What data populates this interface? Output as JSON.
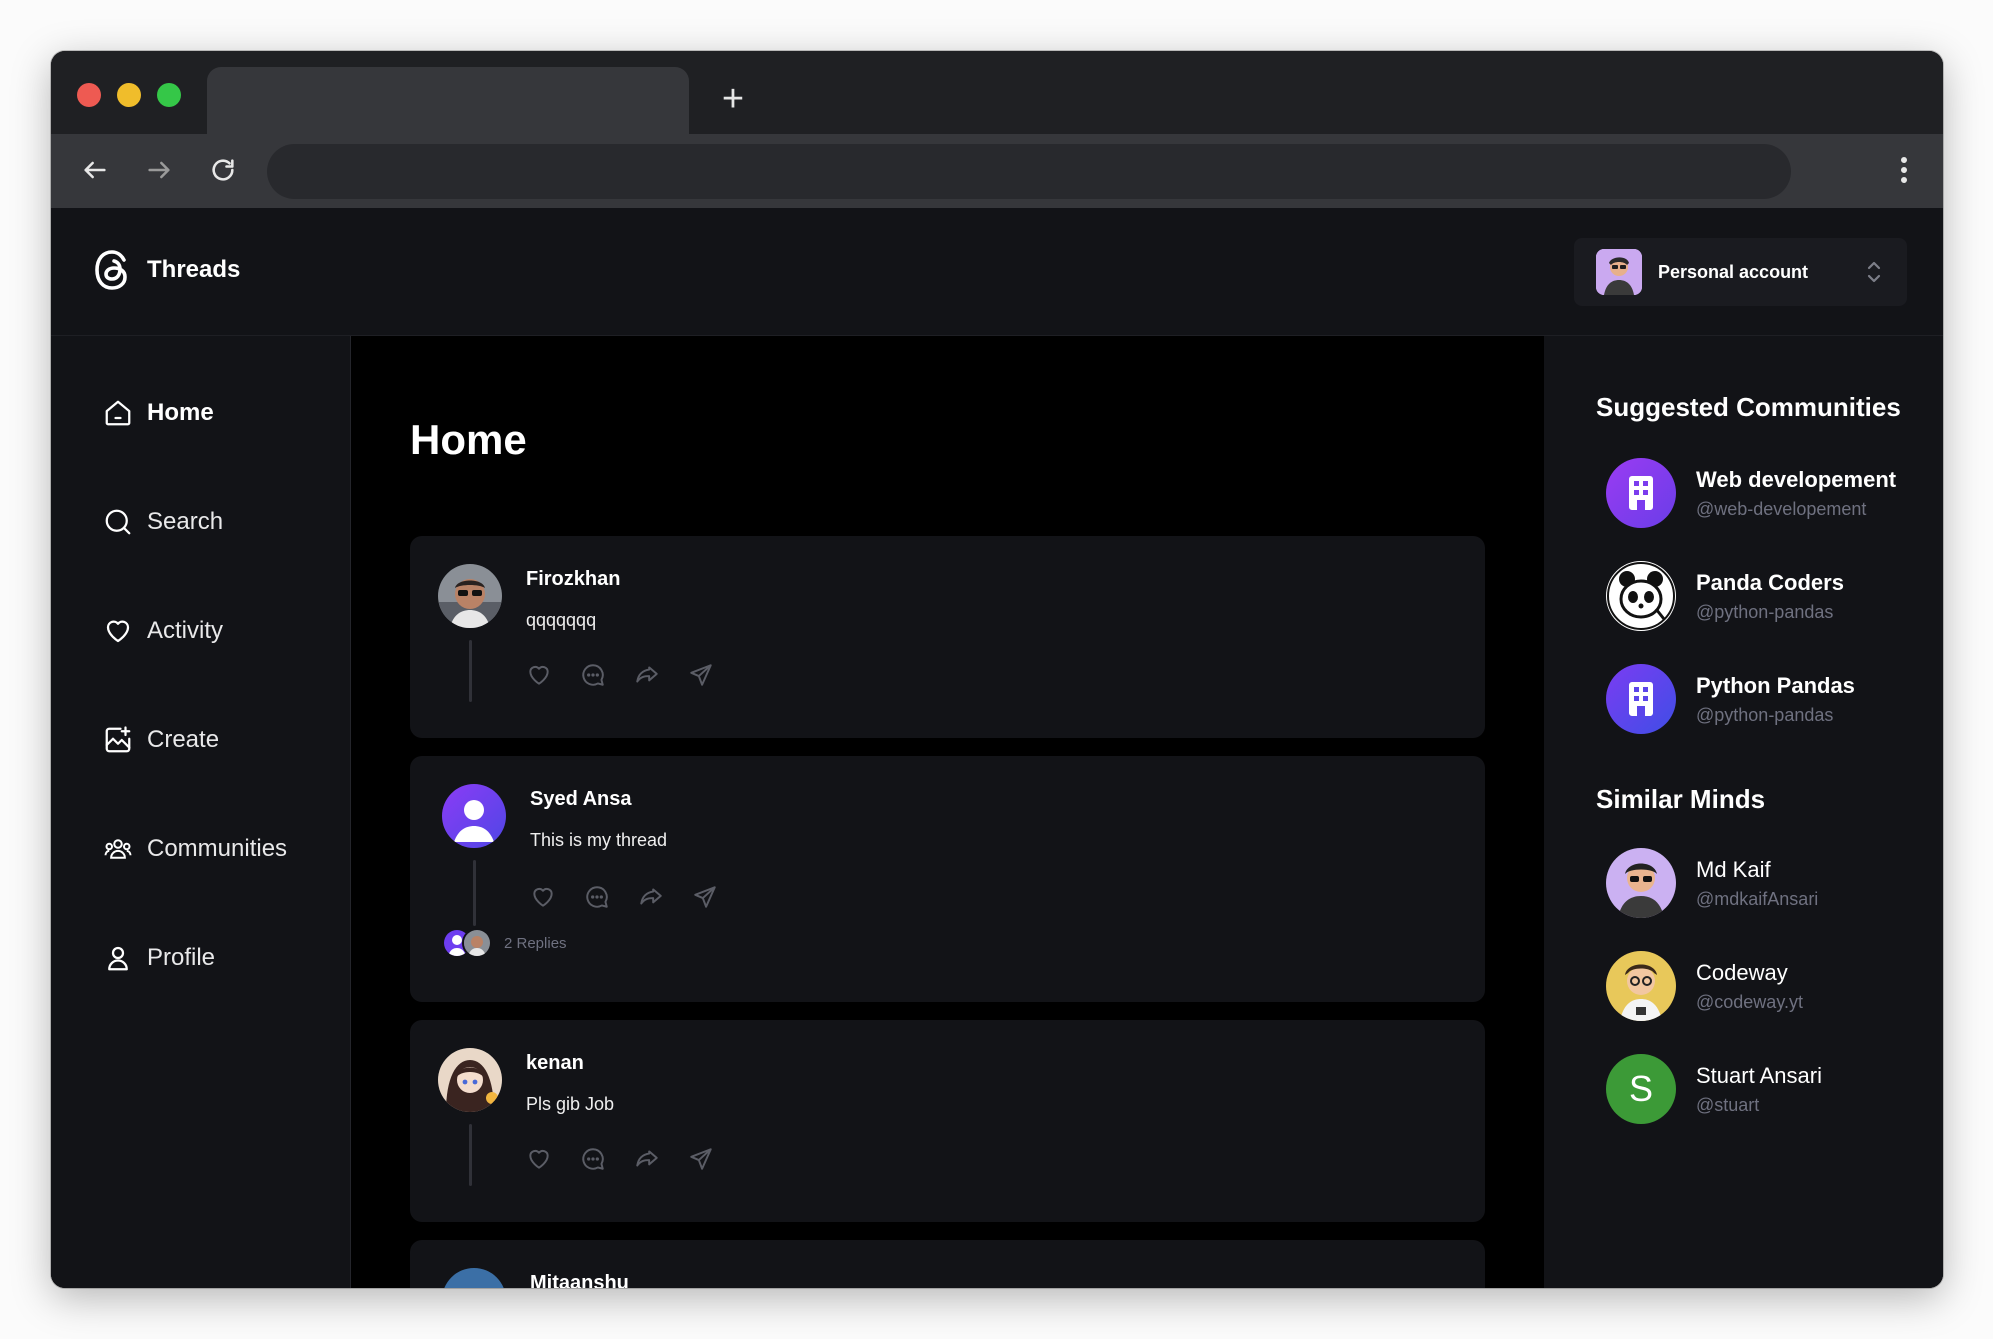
{
  "browser": {
    "tab_title": "",
    "new_tab_symbol": "+",
    "url": ""
  },
  "app": {
    "logo_text": "Threads",
    "account_label": "Personal account"
  },
  "nav": {
    "items": [
      {
        "label": "Home",
        "icon": "home-icon",
        "active": true
      },
      {
        "label": "Search",
        "icon": "search-icon",
        "active": false
      },
      {
        "label": "Activity",
        "icon": "heart-icon",
        "active": false
      },
      {
        "label": "Create",
        "icon": "create-icon",
        "active": false
      },
      {
        "label": "Communities",
        "icon": "communities-icon",
        "active": false
      },
      {
        "label": "Profile",
        "icon": "user-icon",
        "active": false
      }
    ]
  },
  "main": {
    "title": "Home",
    "posts": [
      {
        "author": "Firozkhan",
        "text": "qqqqqqq",
        "replies": ""
      },
      {
        "author": "Syed Ansa",
        "text": "This is my thread",
        "replies": "2 Replies"
      },
      {
        "author": "kenan",
        "text": "Pls gib Job",
        "replies": ""
      },
      {
        "author": "Mitaanshu",
        "text": "",
        "replies": ""
      }
    ]
  },
  "sidebar_right": {
    "communities_heading": "Suggested Communities",
    "communities": [
      {
        "name": "Web developement",
        "handle": "@web-developement"
      },
      {
        "name": "Panda Coders",
        "handle": "@python-pandas"
      },
      {
        "name": "Python Pandas",
        "handle": "@python-pandas"
      }
    ],
    "minds_heading": "Similar Minds",
    "minds": [
      {
        "name": "Md Kaif",
        "handle": "@mdkaifAnsari"
      },
      {
        "name": "Codeway",
        "handle": "@codeway.yt"
      },
      {
        "name": "Stuart Ansari",
        "handle": "@stuart",
        "initial": "S"
      }
    ]
  },
  "colors": {
    "background": "#000000",
    "panel": "#121317",
    "card": "#121317",
    "muted_text": "#6f7180",
    "accent_purple": "#7c3aed",
    "avatar_green": "#3c9a37"
  }
}
